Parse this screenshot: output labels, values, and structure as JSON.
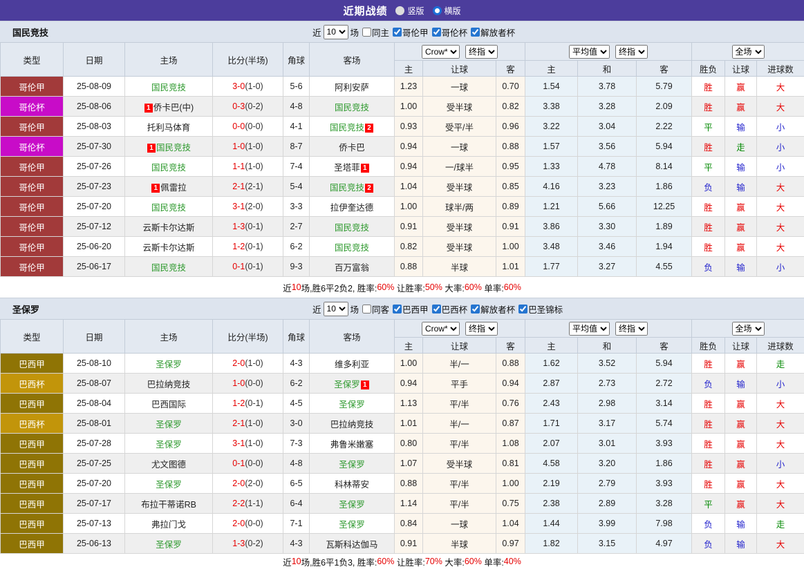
{
  "title_bar": {
    "title": "近期战绩",
    "radio_vertical": "竖版",
    "radio_horizontal": "横版"
  },
  "ui": {
    "near_label": "近",
    "games_label": "场"
  },
  "header": {
    "type": "类型",
    "date": "日期",
    "home": "主场",
    "score": "比分(半场)",
    "corner": "角球",
    "away": "客场",
    "sub": [
      "主",
      "让球",
      "客",
      "主",
      "和",
      "客",
      "胜负",
      "让球",
      "进球数"
    ],
    "selects": {
      "crow": "Crow*",
      "final1": "终指",
      "avg": "平均值",
      "final2": "终指",
      "full": "全场"
    }
  },
  "sections": [
    {
      "team": "国民竞技",
      "filter": {
        "count": "10",
        "same_label": "同主",
        "same_checked": false,
        "leagues": [
          {
            "label": "哥伦甲",
            "checked": true
          },
          {
            "label": "哥伦杯",
            "checked": true
          },
          {
            "label": "解放者杯",
            "checked": true
          }
        ]
      },
      "rows": [
        {
          "league": "哥伦甲",
          "lc": "gja",
          "date": "25-08-09",
          "home": {
            "n": "国民竞技",
            "g": 1
          },
          "ft": "3-0",
          "ht": "(1-0)",
          "cn": "5-6",
          "away": {
            "n": "阿利安萨"
          },
          "o": [
            "1.23",
            "一球",
            "0.70"
          ],
          "a": [
            "1.54",
            "3.78",
            "5.79"
          ],
          "r": [
            "胜",
            "赢",
            "大"
          ]
        },
        {
          "league": "哥伦杯",
          "lc": "gbe",
          "date": "25-08-06",
          "home": {
            "c1": "1",
            "n": "侨卡巴(中)"
          },
          "ft": "0-3",
          "ht": "(0-2)",
          "cn": "4-8",
          "away": {
            "n": "国民竞技",
            "g": 1
          },
          "o": [
            "1.00",
            "受半球",
            "0.82"
          ],
          "a": [
            "3.38",
            "3.28",
            "2.09"
          ],
          "r": [
            "胜",
            "赢",
            "大"
          ]
        },
        {
          "league": "哥伦甲",
          "lc": "gja",
          "date": "25-08-03",
          "home": {
            "n": "托利马体育"
          },
          "ft": "0-0",
          "ht": "(0-0)",
          "cn": "4-1",
          "away": {
            "n": "国民竞技",
            "g": 1,
            "c2": "2"
          },
          "o": [
            "0.93",
            "受平/半",
            "0.96"
          ],
          "a": [
            "3.22",
            "3.04",
            "2.22"
          ],
          "r": [
            "平",
            "输",
            "小"
          ]
        },
        {
          "league": "哥伦杯",
          "lc": "gbe",
          "date": "25-07-30",
          "home": {
            "c1": "1",
            "n": "国民竞技",
            "g": 1
          },
          "ft": "1-0",
          "ht": "(1-0)",
          "cn": "8-7",
          "away": {
            "n": "侨卡巴"
          },
          "o": [
            "0.94",
            "一球",
            "0.88"
          ],
          "a": [
            "1.57",
            "3.56",
            "5.94"
          ],
          "r": [
            "胜",
            "走",
            "小"
          ]
        },
        {
          "league": "哥伦甲",
          "lc": "gja",
          "date": "25-07-26",
          "home": {
            "n": "国民竞技",
            "g": 1
          },
          "ft": "1-1",
          "ht": "(1-0)",
          "cn": "7-4",
          "away": {
            "n": "圣塔菲",
            "c2": "1"
          },
          "o": [
            "0.94",
            "一/球半",
            "0.95"
          ],
          "a": [
            "1.33",
            "4.78",
            "8.14"
          ],
          "r": [
            "平",
            "输",
            "小"
          ]
        },
        {
          "league": "哥伦甲",
          "lc": "gja",
          "date": "25-07-23",
          "home": {
            "c1": "1",
            "n": "佩雷拉"
          },
          "ft": "2-1",
          "ht": "(2-1)",
          "cn": "5-4",
          "away": {
            "n": "国民竞技",
            "g": 1,
            "c2": "2"
          },
          "o": [
            "1.04",
            "受半球",
            "0.85"
          ],
          "a": [
            "4.16",
            "3.23",
            "1.86"
          ],
          "r": [
            "负",
            "输",
            "大"
          ]
        },
        {
          "league": "哥伦甲",
          "lc": "gja",
          "date": "25-07-20",
          "home": {
            "n": "国民竞技",
            "g": 1
          },
          "ft": "3-1",
          "ht": "(2-0)",
          "cn": "3-3",
          "away": {
            "n": "拉伊奎达德"
          },
          "o": [
            "1.00",
            "球半/两",
            "0.89"
          ],
          "a": [
            "1.21",
            "5.66",
            "12.25"
          ],
          "r": [
            "胜",
            "赢",
            "大"
          ]
        },
        {
          "league": "哥伦甲",
          "lc": "gja",
          "date": "25-07-12",
          "home": {
            "n": "云斯卡尔达斯"
          },
          "ft": "1-3",
          "ht": "(0-1)",
          "cn": "2-7",
          "away": {
            "n": "国民竞技",
            "g": 1
          },
          "o": [
            "0.91",
            "受半球",
            "0.91"
          ],
          "a": [
            "3.86",
            "3.30",
            "1.89"
          ],
          "r": [
            "胜",
            "赢",
            "大"
          ]
        },
        {
          "league": "哥伦甲",
          "lc": "gja",
          "date": "25-06-20",
          "home": {
            "n": "云斯卡尔达斯"
          },
          "ft": "1-2",
          "ht": "(0-1)",
          "cn": "6-2",
          "away": {
            "n": "国民竞技",
            "g": 1
          },
          "o": [
            "0.82",
            "受半球",
            "1.00"
          ],
          "a": [
            "3.48",
            "3.46",
            "1.94"
          ],
          "r": [
            "胜",
            "赢",
            "大"
          ]
        },
        {
          "league": "哥伦甲",
          "lc": "gja",
          "date": "25-06-17",
          "home": {
            "n": "国民竞技",
            "g": 1
          },
          "ft": "0-1",
          "ht": "(0-1)",
          "cn": "9-3",
          "away": {
            "n": "百万富翁"
          },
          "o": [
            "0.88",
            "半球",
            "1.01"
          ],
          "a": [
            "1.77",
            "3.27",
            "4.55"
          ],
          "r": [
            "负",
            "输",
            "小"
          ]
        }
      ],
      "summary": [
        {
          "t": "近",
          "r": 0
        },
        {
          "t": "10",
          "r": 1
        },
        {
          "t": "场,胜6平2负2, 胜率:",
          "r": 0
        },
        {
          "t": "60%",
          "r": 1
        },
        {
          "t": " 让胜率:",
          "r": 0
        },
        {
          "t": "50%",
          "r": 1
        },
        {
          "t": " 大率:",
          "r": 0
        },
        {
          "t": "60%",
          "r": 1
        },
        {
          "t": " 单率:",
          "r": 0
        },
        {
          "t": "60%",
          "r": 1
        }
      ]
    },
    {
      "team": "圣保罗",
      "filter": {
        "count": "10",
        "same_label": "同客",
        "same_checked": false,
        "leagues": [
          {
            "label": "巴西甲",
            "checked": true
          },
          {
            "label": "巴西杯",
            "checked": true
          },
          {
            "label": "解放者杯",
            "checked": true
          },
          {
            "label": "巴圣锦标",
            "checked": true
          }
        ]
      },
      "rows": [
        {
          "league": "巴西甲",
          "lc": "bja",
          "date": "25-08-10",
          "home": {
            "n": "圣保罗",
            "g": 1
          },
          "ft": "2-0",
          "ht": "(1-0)",
          "cn": "4-3",
          "away": {
            "n": "维多利亚"
          },
          "o": [
            "1.00",
            "半/一",
            "0.88"
          ],
          "a": [
            "1.62",
            "3.52",
            "5.94"
          ],
          "r": [
            "胜",
            "赢",
            "走"
          ]
        },
        {
          "league": "巴西杯",
          "lc": "bbe",
          "date": "25-08-07",
          "home": {
            "n": "巴拉纳竞技"
          },
          "ft": "1-0",
          "ht": "(0-0)",
          "cn": "6-2",
          "away": {
            "n": "圣保罗",
            "g": 1,
            "c2": "1"
          },
          "o": [
            "0.94",
            "平手",
            "0.94"
          ],
          "a": [
            "2.87",
            "2.73",
            "2.72"
          ],
          "r": [
            "负",
            "输",
            "小"
          ]
        },
        {
          "league": "巴西甲",
          "lc": "bja",
          "date": "25-08-04",
          "home": {
            "n": "巴西国际"
          },
          "ft": "1-2",
          "ht": "(0-1)",
          "cn": "4-5",
          "away": {
            "n": "圣保罗",
            "g": 1
          },
          "o": [
            "1.13",
            "平/半",
            "0.76"
          ],
          "a": [
            "2.43",
            "2.98",
            "3.14"
          ],
          "r": [
            "胜",
            "赢",
            "大"
          ]
        },
        {
          "league": "巴西杯",
          "lc": "bbe",
          "date": "25-08-01",
          "home": {
            "n": "圣保罗",
            "g": 1
          },
          "ft": "2-1",
          "ht": "(1-0)",
          "cn": "3-0",
          "away": {
            "n": "巴拉纳竞技"
          },
          "o": [
            "1.01",
            "半/一",
            "0.87"
          ],
          "a": [
            "1.71",
            "3.17",
            "5.74"
          ],
          "r": [
            "胜",
            "赢",
            "大"
          ]
        },
        {
          "league": "巴西甲",
          "lc": "bja",
          "date": "25-07-28",
          "home": {
            "n": "圣保罗",
            "g": 1
          },
          "ft": "3-1",
          "ht": "(1-0)",
          "cn": "7-3",
          "away": {
            "n": "弗鲁米嫩塞"
          },
          "o": [
            "0.80",
            "平/半",
            "1.08"
          ],
          "a": [
            "2.07",
            "3.01",
            "3.93"
          ],
          "r": [
            "胜",
            "赢",
            "大"
          ]
        },
        {
          "league": "巴西甲",
          "lc": "bja",
          "date": "25-07-25",
          "home": {
            "n": "尤文图德"
          },
          "ft": "0-1",
          "ht": "(0-0)",
          "cn": "4-8",
          "away": {
            "n": "圣保罗",
            "g": 1
          },
          "o": [
            "1.07",
            "受半球",
            "0.81"
          ],
          "a": [
            "4.58",
            "3.20",
            "1.86"
          ],
          "r": [
            "胜",
            "赢",
            "小"
          ]
        },
        {
          "league": "巴西甲",
          "lc": "bja",
          "date": "25-07-20",
          "home": {
            "n": "圣保罗",
            "g": 1
          },
          "ft": "2-0",
          "ht": "(2-0)",
          "cn": "6-5",
          "away": {
            "n": "科林蒂安"
          },
          "o": [
            "0.88",
            "平/半",
            "1.00"
          ],
          "a": [
            "2.19",
            "2.79",
            "3.93"
          ],
          "r": [
            "胜",
            "赢",
            "大"
          ]
        },
        {
          "league": "巴西甲",
          "lc": "bja",
          "date": "25-07-17",
          "home": {
            "n": "布拉干蒂诺RB"
          },
          "ft": "2-2",
          "ht": "(1-1)",
          "cn": "6-4",
          "away": {
            "n": "圣保罗",
            "g": 1
          },
          "o": [
            "1.14",
            "平/半",
            "0.75"
          ],
          "a": [
            "2.38",
            "2.89",
            "3.28"
          ],
          "r": [
            "平",
            "赢",
            "大"
          ]
        },
        {
          "league": "巴西甲",
          "lc": "bja",
          "date": "25-07-13",
          "home": {
            "n": "弗拉门戈"
          },
          "ft": "2-0",
          "ht": "(0-0)",
          "cn": "7-1",
          "away": {
            "n": "圣保罗",
            "g": 1
          },
          "o": [
            "0.84",
            "一球",
            "1.04"
          ],
          "a": [
            "1.44",
            "3.99",
            "7.98"
          ],
          "r": [
            "负",
            "输",
            "走"
          ]
        },
        {
          "league": "巴西甲",
          "lc": "bja",
          "date": "25-06-13",
          "home": {
            "n": "圣保罗",
            "g": 1
          },
          "ft": "1-3",
          "ht": "(0-2)",
          "cn": "4-3",
          "away": {
            "n": "瓦斯科达伽马"
          },
          "o": [
            "0.91",
            "半球",
            "0.97"
          ],
          "a": [
            "1.82",
            "3.15",
            "4.97"
          ],
          "r": [
            "负",
            "输",
            "大"
          ]
        }
      ],
      "summary": [
        {
          "t": "近",
          "r": 0
        },
        {
          "t": "10",
          "r": 1
        },
        {
          "t": "场,胜6平1负3, 胜率:",
          "r": 0
        },
        {
          "t": "60%",
          "r": 1
        },
        {
          "t": " 让胜率:",
          "r": 0
        },
        {
          "t": "70%",
          "r": 1
        },
        {
          "t": " 大率:",
          "r": 0
        },
        {
          "t": "60%",
          "r": 1
        },
        {
          "t": " 单率:",
          "r": 0
        },
        {
          "t": "40%",
          "r": 1
        }
      ]
    }
  ],
  "colors": {
    "title_bar": "#4c3d9c",
    "section_bar": "#dde4ee",
    "header_cell": "#e3e9f1",
    "league_gelunjia": "#a23a3a",
    "league_gelunbei": "#c80cc8",
    "league_baxijia": "#8f7405",
    "league_baxibei": "#c2950a",
    "focal_team_green": "#2f9a2f",
    "score_red": "#e60000",
    "win_red": "#e60000",
    "draw_green": "#008800",
    "lose_blue": "#2222cc",
    "crow_cell_bg": "#fcf6ed",
    "avg_cell_bg": "#e9f2f8"
  }
}
